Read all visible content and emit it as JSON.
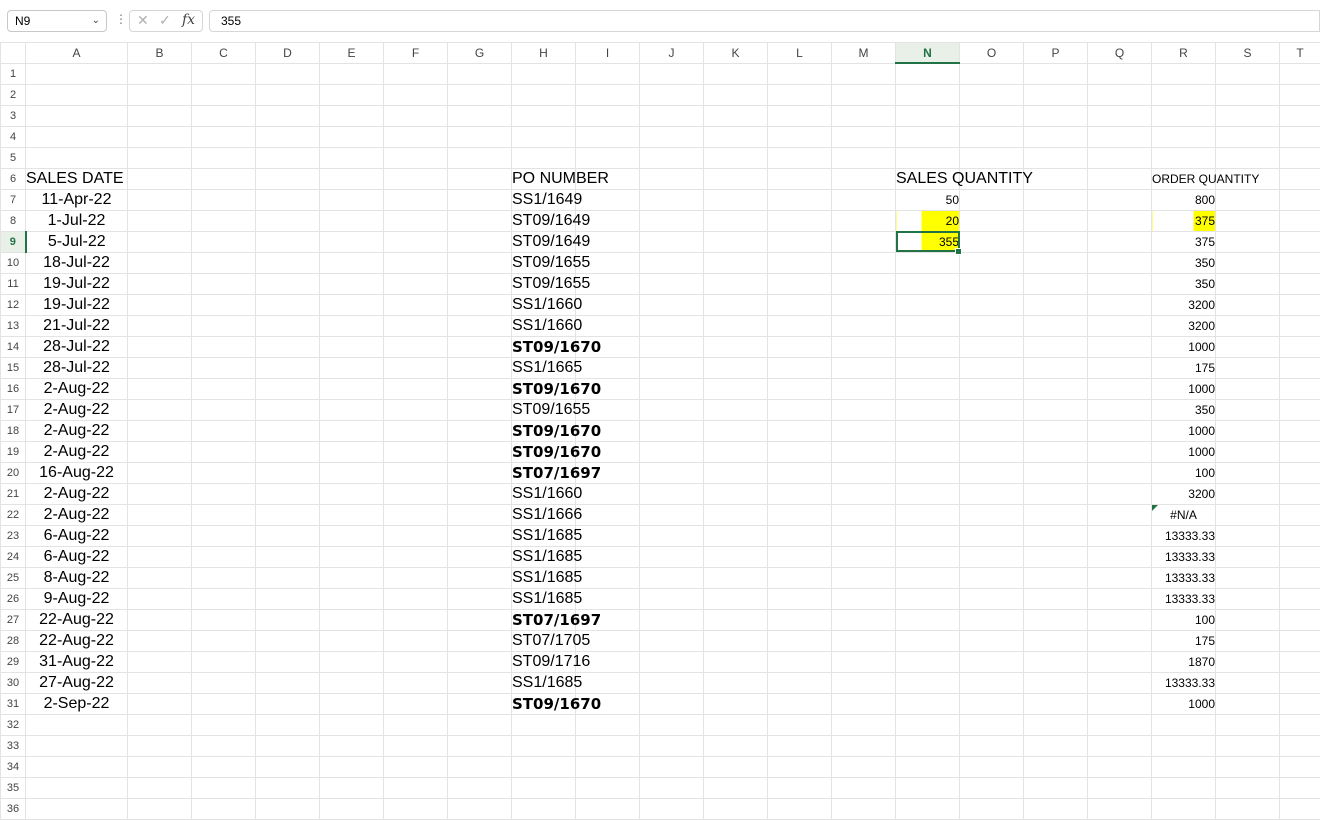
{
  "formula_bar": {
    "name_box": "N9",
    "formula": "355"
  },
  "columns": [
    "A",
    "B",
    "C",
    "D",
    "E",
    "F",
    "G",
    "H",
    "I",
    "J",
    "K",
    "L",
    "M",
    "N",
    "O",
    "P",
    "Q",
    "R",
    "S",
    "T"
  ],
  "selected_column": "N",
  "selected_row": 9,
  "headers": {
    "sales_date": "SALES DATE",
    "po_number": "PO NUMBER",
    "sales_quantity": "SALES QUANTITY",
    "order_quantity": "ORDER QUANTITY"
  },
  "rows": [
    {
      "row": 7,
      "date": "11-Apr-22",
      "po": "SS1/1649",
      "po_bold": false,
      "sales_qty": "50",
      "order_qty": "800"
    },
    {
      "row": 8,
      "date": "1-Jul-22",
      "po": "ST09/1649",
      "po_bold": false,
      "sales_qty": "20",
      "order_qty": "375"
    },
    {
      "row": 9,
      "date": "5-Jul-22",
      "po": "ST09/1649",
      "po_bold": false,
      "sales_qty": "355",
      "order_qty": "375"
    },
    {
      "row": 10,
      "date": "18-Jul-22",
      "po": "ST09/1655",
      "po_bold": false,
      "sales_qty": "",
      "order_qty": "350"
    },
    {
      "row": 11,
      "date": "19-Jul-22",
      "po": "ST09/1655",
      "po_bold": false,
      "sales_qty": "",
      "order_qty": "350"
    },
    {
      "row": 12,
      "date": "19-Jul-22",
      "po": "SS1/1660",
      "po_bold": false,
      "sales_qty": "",
      "order_qty": "3200"
    },
    {
      "row": 13,
      "date": "21-Jul-22",
      "po": "SS1/1660",
      "po_bold": false,
      "sales_qty": "",
      "order_qty": "3200"
    },
    {
      "row": 14,
      "date": "28-Jul-22",
      "po": "ST09/1670",
      "po_bold": true,
      "sales_qty": "",
      "order_qty": "1000"
    },
    {
      "row": 15,
      "date": "28-Jul-22",
      "po": "SS1/1665",
      "po_bold": false,
      "sales_qty": "",
      "order_qty": "175"
    },
    {
      "row": 16,
      "date": "2-Aug-22",
      "po": "ST09/1670",
      "po_bold": true,
      "sales_qty": "",
      "order_qty": "1000"
    },
    {
      "row": 17,
      "date": "2-Aug-22",
      "po": "ST09/1655",
      "po_bold": false,
      "sales_qty": "",
      "order_qty": "350"
    },
    {
      "row": 18,
      "date": "2-Aug-22",
      "po": "ST09/1670",
      "po_bold": true,
      "sales_qty": "",
      "order_qty": "1000"
    },
    {
      "row": 19,
      "date": "2-Aug-22",
      "po": "ST09/1670",
      "po_bold": true,
      "sales_qty": "",
      "order_qty": "1000"
    },
    {
      "row": 20,
      "date": "16-Aug-22",
      "po": "ST07/1697",
      "po_bold": true,
      "sales_qty": "",
      "order_qty": "100"
    },
    {
      "row": 21,
      "date": "2-Aug-22",
      "po": "SS1/1660",
      "po_bold": false,
      "sales_qty": "",
      "order_qty": "3200"
    },
    {
      "row": 22,
      "date": "2-Aug-22",
      "po": "SS1/1666",
      "po_bold": false,
      "sales_qty": "",
      "order_qty": "#N/A"
    },
    {
      "row": 23,
      "date": "6-Aug-22",
      "po": "SS1/1685",
      "po_bold": false,
      "sales_qty": "",
      "order_qty": "13333.33"
    },
    {
      "row": 24,
      "date": "6-Aug-22",
      "po": "SS1/1685",
      "po_bold": false,
      "sales_qty": "",
      "order_qty": "13333.33"
    },
    {
      "row": 25,
      "date": "8-Aug-22",
      "po": "SS1/1685",
      "po_bold": false,
      "sales_qty": "",
      "order_qty": "13333.33"
    },
    {
      "row": 26,
      "date": "9-Aug-22",
      "po": "SS1/1685",
      "po_bold": false,
      "sales_qty": "",
      "order_qty": "13333.33"
    },
    {
      "row": 27,
      "date": "22-Aug-22",
      "po": "ST07/1697",
      "po_bold": true,
      "sales_qty": "",
      "order_qty": "100"
    },
    {
      "row": 28,
      "date": "22-Aug-22",
      "po": "ST07/1705",
      "po_bold": false,
      "sales_qty": "",
      "order_qty": "175"
    },
    {
      "row": 29,
      "date": "31-Aug-22",
      "po": "ST09/1716",
      "po_bold": false,
      "sales_qty": "",
      "order_qty": "1870"
    },
    {
      "row": 30,
      "date": "27-Aug-22",
      "po": "SS1/1685",
      "po_bold": false,
      "sales_qty": "",
      "order_qty": "13333.33"
    },
    {
      "row": 31,
      "date": "2-Sep-22",
      "po": "ST09/1670",
      "po_bold": true,
      "sales_qty": "",
      "order_qty": "1000"
    }
  ],
  "highlight_color": "#ffff00",
  "accent_color": "#217346"
}
